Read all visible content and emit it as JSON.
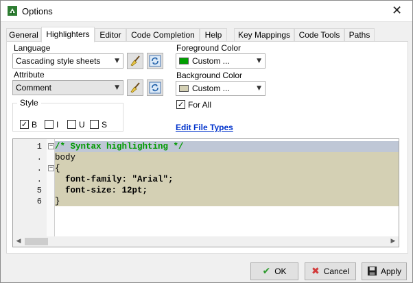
{
  "window": {
    "title": "Options",
    "close_glyph": "✕"
  },
  "tabs": [
    {
      "label": "General"
    },
    {
      "label": "Highlighters",
      "active": true
    },
    {
      "label": "Editor"
    },
    {
      "label": "Code Completion"
    },
    {
      "label": "Help"
    },
    {
      "label": "Key Mappings"
    },
    {
      "label": "Code Tools"
    },
    {
      "label": "Paths"
    }
  ],
  "language": {
    "label": "Language",
    "value": "Cascading style sheets"
  },
  "attribute": {
    "label": "Attribute",
    "value": "Comment"
  },
  "foreground": {
    "label": "Foreground Color",
    "value": "Custom ...",
    "swatch": "#00a000"
  },
  "background": {
    "label": "Background Color",
    "value": "Custom ...",
    "swatch": "#d4d0b4"
  },
  "for_all": {
    "label": "For All",
    "checked": true
  },
  "edit_file_types": "Edit File Types",
  "style": {
    "title": "Style",
    "options": [
      {
        "label": "B",
        "checked": true
      },
      {
        "label": "I",
        "checked": false
      },
      {
        "label": "U",
        "checked": false
      },
      {
        "label": "S",
        "checked": false
      }
    ]
  },
  "editor": {
    "line_numbers": [
      "1",
      ".",
      ".",
      ".",
      "5",
      "6"
    ],
    "lines": [
      "/* Syntax highlighting */",
      "body",
      "{",
      "  font-family: \"Arial\";",
      "  font-size: 12pt;",
      "}"
    ]
  },
  "buttons": {
    "ok": "OK",
    "cancel": "Cancel",
    "apply": "Apply"
  },
  "icons": {
    "check": "✔",
    "cross": "✖",
    "save": "💾",
    "broom": "🧹",
    "refresh": "⟳"
  }
}
